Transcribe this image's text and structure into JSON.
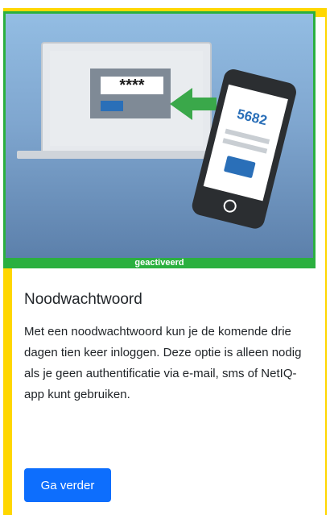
{
  "card": {
    "status_label": "geactiveerd",
    "title": "Noodwachtwoord",
    "description": "Met een noodwachtwoord kun je de komende drie dagen tien keer inloggen. Deze optie is alleen nodig als je geen authentificatie via e-mail, sms of NetIQ-app kunt gebruiken.",
    "button_label": "Ga verder"
  },
  "illustration": {
    "laptop_password": "****",
    "phone_code": "5682"
  },
  "colors": {
    "border_accent": "#FFD700",
    "status_green": "#2bb03f",
    "button_blue": "#0d6efd",
    "screen_button_blue": "#2a6fb8"
  },
  "icons": {
    "arrow": "left-arrow-icon",
    "laptop": "laptop-icon",
    "phone": "smartphone-icon"
  }
}
